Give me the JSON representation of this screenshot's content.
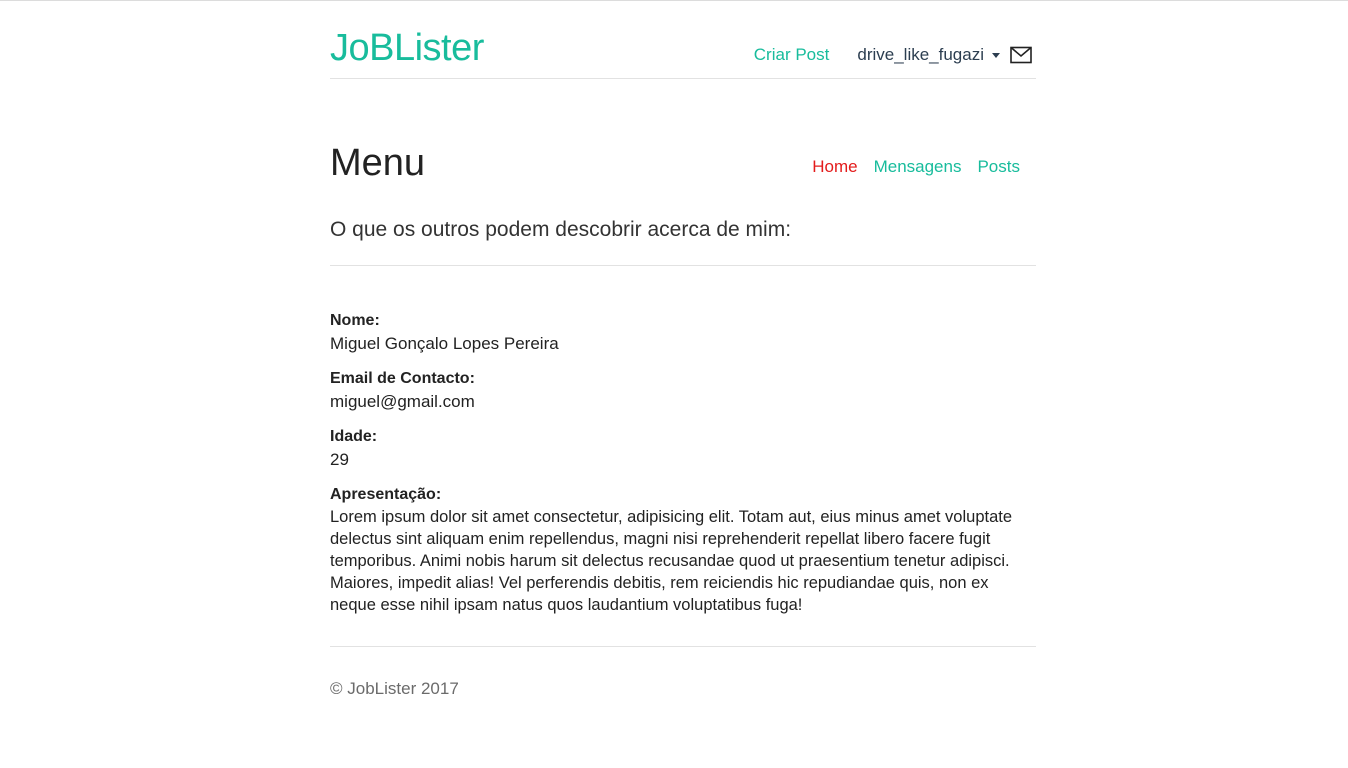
{
  "header": {
    "brand": "JoBLister",
    "create_post_label": "Criar Post",
    "username": "drive_like_fugazi",
    "mail_icon": "envelope-icon"
  },
  "page": {
    "title": "Menu",
    "tabs": [
      {
        "label": "Home",
        "active": true
      },
      {
        "label": "Mensagens",
        "active": false
      },
      {
        "label": "Posts",
        "active": false
      }
    ],
    "lead": "O que os outros podem descobrir acerca de mim:"
  },
  "profile": {
    "name_label": "Nome:",
    "name_value": "Miguel Gonçalo Lopes Pereira",
    "email_label": "Email de Contacto:",
    "email_value": "miguel@gmail.com",
    "age_label": "Idade:",
    "age_value": "29",
    "bio_label": "Apresentação:",
    "bio_value": "Lorem ipsum dolor sit amet consectetur, adipisicing elit. Totam aut, eius minus amet voluptate delectus sint aliquam enim repellendus, magni nisi reprehenderit repellat libero facere fugit temporibus. Animi nobis harum sit delectus recusandae quod ut praesentium tenetur adipisci. Maiores, impedit alias! Vel perferendis debitis, rem reiciendis hic repudiandae quis, non ex neque esse nihil ipsam natus quos laudantium voluptatibus fuga!"
  },
  "footer": {
    "copyright": "© JobLister 2017"
  },
  "colors": {
    "accent": "#18bc9c",
    "active_tab": "#e31b1b",
    "text": "#222222"
  }
}
